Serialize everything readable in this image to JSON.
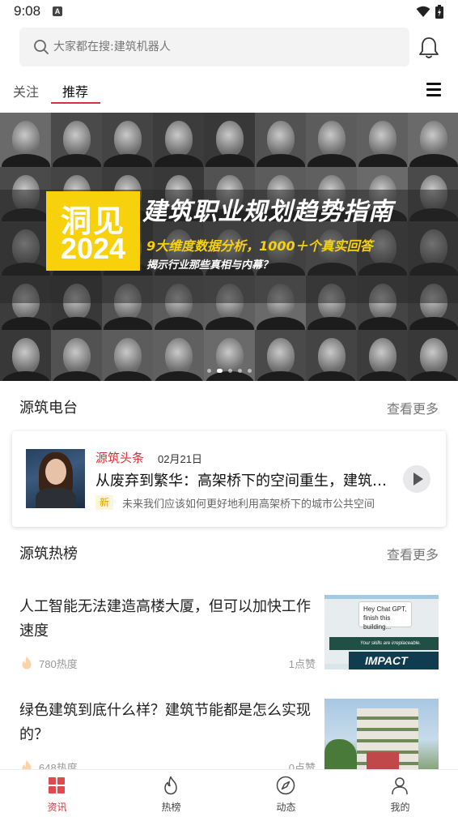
{
  "status_bar": {
    "time": "9:08",
    "app_icon": "A"
  },
  "search": {
    "placeholder": "大家都在搜:建筑机器人"
  },
  "tabs": [
    {
      "label": "关注",
      "active": false
    },
    {
      "label": "推荐",
      "active": true
    }
  ],
  "banner": {
    "logo_line1": "洞见",
    "logo_line2": "2024",
    "title": "建筑职业规划趋势指南",
    "subtitle1": "9大维度数据分析，1000＋个真实回答",
    "subtitle2": "揭示行业那些真相与内幕？",
    "slide_count": 5,
    "active_slide": 1
  },
  "radio_section": {
    "title": "源筑电台",
    "more": "查看更多"
  },
  "radio_item": {
    "source": "源筑头条",
    "date": "02月21日",
    "title": "从废弃到繁华：高架桥下的空间重生，建筑师们的创意实践",
    "badge": "新",
    "description": "未来我们应该如何更好地利用高架桥下的城市公共空间"
  },
  "hot_section": {
    "title": "源筑热榜",
    "more": "查看更多"
  },
  "articles": [
    {
      "title": "人工智能无法建造高楼大厦，但可以加快工作速度",
      "heat": "780热度",
      "likes": "1点赞",
      "thumb_text": {
        "bubble": "Hey Chat GPT, finish this building...",
        "strip": "Your skills are irreplaceable.",
        "brand": "IMPACT"
      }
    },
    {
      "title": "绿色建筑到底什么样？建筑节能都是怎么实现的？",
      "heat": "648热度",
      "likes": "0点赞"
    }
  ],
  "bottom_nav": [
    {
      "label": "资讯",
      "icon": "news-grid-icon",
      "active": true
    },
    {
      "label": "热榜",
      "icon": "flame-icon",
      "active": false
    },
    {
      "label": "动态",
      "icon": "compass-icon",
      "active": false
    },
    {
      "label": "我的",
      "icon": "person-icon",
      "active": false
    }
  ],
  "colors": {
    "accent": "#d9323a",
    "banner_yellow": "#f7d10b"
  }
}
